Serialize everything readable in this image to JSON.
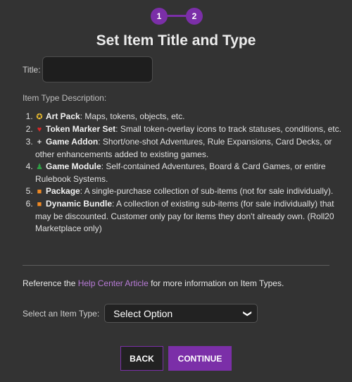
{
  "stepper": {
    "steps": [
      "1",
      "2"
    ],
    "active_step": 2
  },
  "heading": "Set Item Title and Type",
  "title_field": {
    "label": "Title:",
    "value": ""
  },
  "type_description_label": "Item Type Description:",
  "item_types": [
    {
      "icon": "art-pack-icon",
      "glyph": "✪",
      "name": "Art Pack",
      "description": ": Maps, tokens, objects, etc."
    },
    {
      "icon": "heart-icon",
      "glyph": "♥",
      "name": "Token Marker Set",
      "description": ": Small token-overlay icons to track statuses, conditions, etc."
    },
    {
      "icon": "plus-icon",
      "glyph": "+",
      "name": "Game Addon",
      "description": ": Short/one-shot Adventures, Rule Expansions, Card Decks, or other enhancements added to existing games."
    },
    {
      "icon": "character-icon",
      "glyph": "♟",
      "name": "Game Module",
      "description": ": Self-contained Adventures, Board & Card Games, or entire Rulebook Systems."
    },
    {
      "icon": "gift-icon",
      "glyph": "■",
      "name": "Package",
      "description": ": A single-purchase collection of sub-items (not for sale individually)."
    },
    {
      "icon": "gift-icon",
      "glyph": "■",
      "name": "Dynamic Bundle",
      "description": ": A collection of existing sub-items (for sale individually) that may be discounted. Customer only pay for items they don't already own. (Roll20 Marketplace only)"
    }
  ],
  "reference": {
    "before": "Reference the ",
    "link": "Help Center Article",
    "after": " for more information on Item Types."
  },
  "item_type_select": {
    "label": "Select an Item Type:",
    "value": "Select Option"
  },
  "buttons": {
    "back": "BACK",
    "continue": "CONTINUE"
  },
  "colors": {
    "accent": "#7b2fa8",
    "background": "#333333",
    "link": "#b77bd6"
  }
}
